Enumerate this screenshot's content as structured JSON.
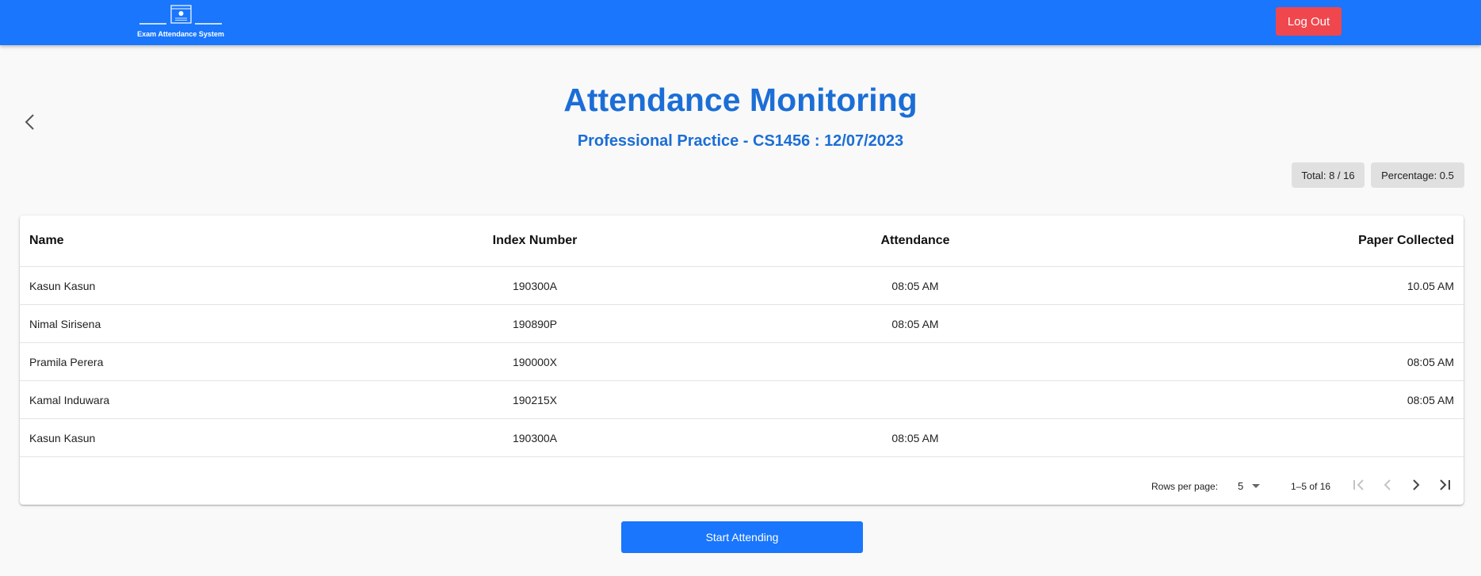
{
  "app": {
    "logo_text": "Exam Attendance System",
    "brand_color": "#1976fd"
  },
  "header": {
    "logout_label": "Log Out",
    "logout_color": "#f0474e"
  },
  "page": {
    "title": "Attendance Monitoring",
    "subtitle": "Professional Practice - CS1456 : 12/07/2023"
  },
  "stats": {
    "total": "Total: 8 / 16",
    "percentage": "Percentage: 0.5"
  },
  "table": {
    "columns": [
      "Name",
      "Index Number",
      "Attendance",
      "Paper Collected"
    ],
    "rows": [
      {
        "name": "Kasun Kasun",
        "index": "190300A",
        "attendance": "08:05 AM",
        "paper": "10.05 AM"
      },
      {
        "name": "Nimal Sirisena",
        "index": "190890P",
        "attendance": "08:05 AM",
        "paper": ""
      },
      {
        "name": "Pramila Perera",
        "index": "190000X",
        "attendance": "",
        "paper": "08:05 AM"
      },
      {
        "name": "Kamal Induwara",
        "index": "190215X",
        "attendance": "",
        "paper": "08:05 AM"
      },
      {
        "name": "Kasun Kasun",
        "index": "190300A",
        "attendance": "08:05 AM",
        "paper": ""
      }
    ]
  },
  "pagination": {
    "rows_per_page_label": "Rows per page:",
    "rows_per_page": "5",
    "range": "1–5 of 16"
  },
  "actions": {
    "start_label": "Start Attending"
  }
}
